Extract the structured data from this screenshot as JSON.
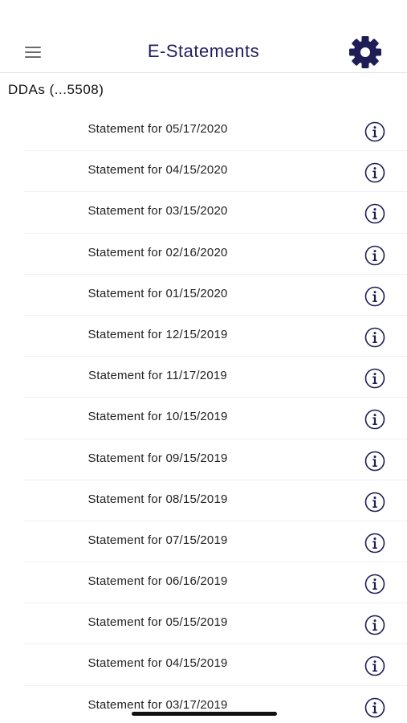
{
  "header": {
    "title": "E-Statements",
    "menu_icon": "hamburger-menu-icon",
    "settings_icon": "gear-icon"
  },
  "account": {
    "label": "DDAs  (...5508)"
  },
  "statements": [
    {
      "label": "Statement for 05/17/2020"
    },
    {
      "label": "Statement for 04/15/2020"
    },
    {
      "label": "Statement for 03/15/2020"
    },
    {
      "label": "Statement for 02/16/2020"
    },
    {
      "label": "Statement for 01/15/2020"
    },
    {
      "label": "Statement for 12/15/2019"
    },
    {
      "label": "Statement for 11/17/2019"
    },
    {
      "label": "Statement for 10/15/2019"
    },
    {
      "label": "Statement for 09/15/2019"
    },
    {
      "label": "Statement for 08/15/2019"
    },
    {
      "label": "Statement for 07/15/2019"
    },
    {
      "label": "Statement for 06/16/2019"
    },
    {
      "label": "Statement for 05/15/2019"
    },
    {
      "label": "Statement for 04/15/2019"
    },
    {
      "label": "Statement for 03/17/2019"
    }
  ],
  "colors": {
    "brand": "#22205e",
    "icon": "#1f1d55"
  }
}
